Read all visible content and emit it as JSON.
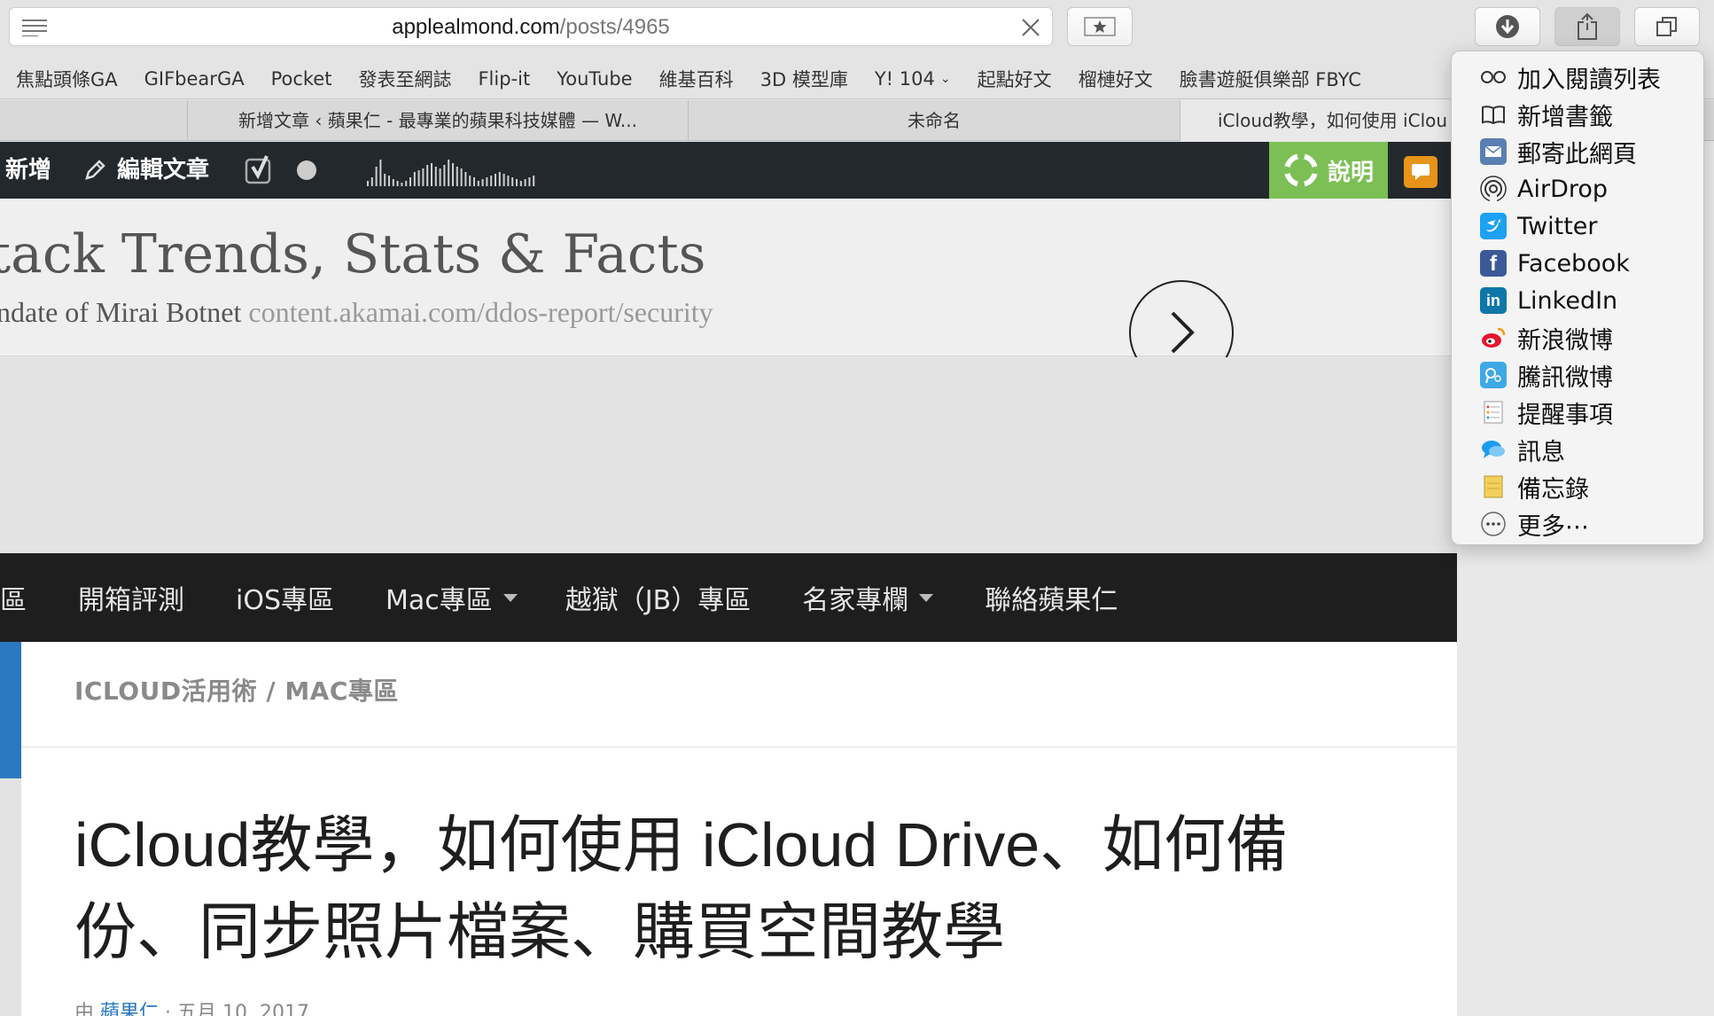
{
  "toolbar": {
    "url_domain": "applealmond.com",
    "url_path": "/posts/4965"
  },
  "bookmarks": [
    {
      "label": "焦點頭條GA"
    },
    {
      "label": "GIFbearGA"
    },
    {
      "label": "Pocket"
    },
    {
      "label": "發表至網誌"
    },
    {
      "label": "Flip-it"
    },
    {
      "label": "YouTube"
    },
    {
      "label": "維基百科"
    },
    {
      "label": "3D 模型庫"
    },
    {
      "label": "Y! 104"
    },
    {
      "label": "起點好文"
    },
    {
      "label": "榴槤好文"
    },
    {
      "label": "臉書遊艇俱樂部 FBYC"
    }
  ],
  "tabs": [
    {
      "label": "新增文章 ‹ 蘋果仁 - 最專業的蘋果科技媒體 — W..."
    },
    {
      "label": "未命名"
    },
    {
      "label": "iCloud教學，如何使用 iClou"
    }
  ],
  "adminbar": {
    "new_label": "新增",
    "edit_label": "編輯文章",
    "help_label": "說明"
  },
  "banner": {
    "headline": "tack Trends, Stats & Facts",
    "sub_text": "ndate of Mirai Botnet",
    "sub_link": "content.akamai.com/ddos-report/security"
  },
  "sitenav": {
    "items": [
      {
        "label": "區"
      },
      {
        "label": "開箱評測"
      },
      {
        "label": "iOS專區"
      },
      {
        "label": "Mac專區"
      },
      {
        "label": "越獄（JB）專區"
      },
      {
        "label": "名家專欄"
      },
      {
        "label": "聯絡蘋果仁"
      }
    ]
  },
  "article": {
    "breadcrumb": "ICLOUD活用術 / MAC專區",
    "title": "iCloud教學，如何使用 iCloud Drive、如何備份、同步照片檔案、購買空間教學",
    "byline_prefix": "由",
    "author": "蘋果仁",
    "date": "· 五月 10, 2017"
  },
  "share_menu": {
    "items": [
      {
        "label": "加入閱讀列表",
        "icon": "reading-list-icon"
      },
      {
        "label": "新增書籤",
        "icon": "bookmark-book-icon"
      },
      {
        "label": "郵寄此網頁",
        "icon": "mail-icon"
      },
      {
        "label": "AirDrop",
        "icon": "airdrop-icon"
      },
      {
        "label": "Twitter",
        "icon": "twitter-icon",
        "color": "#1da1f2"
      },
      {
        "label": "Facebook",
        "icon": "facebook-icon",
        "color": "#3b5998"
      },
      {
        "label": "LinkedIn",
        "icon": "linkedin-icon",
        "color": "#0e76a8"
      },
      {
        "label": "新浪微博",
        "icon": "sina-weibo-icon",
        "color": "#e6162d"
      },
      {
        "label": "騰訊微博",
        "icon": "tencent-weibo-icon",
        "color": "#3fa8e6"
      },
      {
        "label": "提醒事項",
        "icon": "reminders-icon"
      },
      {
        "label": "訊息",
        "icon": "messages-icon",
        "color": "#1c9bf0"
      },
      {
        "label": "備忘錄",
        "icon": "notes-icon",
        "color": "#f1d15a"
      },
      {
        "label": "更多⋯",
        "icon": "more-icon"
      }
    ]
  },
  "colors": {
    "admin_bar": "#23282d",
    "help_green": "#7cbf55",
    "site_nav": "#1e1e1e",
    "accent_blue": "#2a79c0"
  }
}
